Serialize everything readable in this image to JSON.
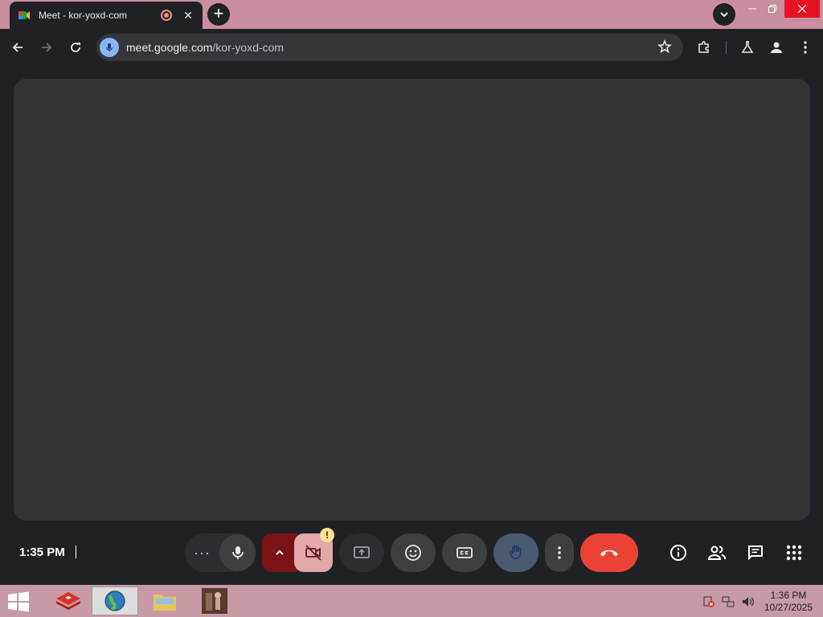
{
  "browser": {
    "tab_title": "Meet - kor-yoxd-com",
    "url_host": "meet.google.com",
    "url_path": "/kor-yoxd-com"
  },
  "meet": {
    "time": "1:35 PM",
    "camera_warning": "!",
    "more_options_dots": "···"
  },
  "colors": {
    "end_call": "#ea4335",
    "camera_off": "#e2a8a8",
    "camera_arrow": "#7a1414",
    "hand_raised": "#4a5a70",
    "stage": "#333334"
  },
  "icons": {
    "toolbar": [
      "back-icon",
      "forward-icon",
      "reload-icon",
      "mic-icon",
      "star-icon",
      "extensions-icon",
      "labs-icon",
      "profile-icon",
      "menu-icon"
    ],
    "controls": [
      "more-dots-icon",
      "microphone-icon",
      "chevron-up-icon",
      "camera-off-icon",
      "present-icon",
      "emoji-icon",
      "captions-icon",
      "hand-icon",
      "more-vert-icon",
      "end-call-icon"
    ],
    "right": [
      "info-icon",
      "people-icon",
      "chat-icon",
      "apps-grid-icon"
    ]
  },
  "taskbar": {
    "time": "1:36 PM",
    "date": "10/27/2025"
  }
}
